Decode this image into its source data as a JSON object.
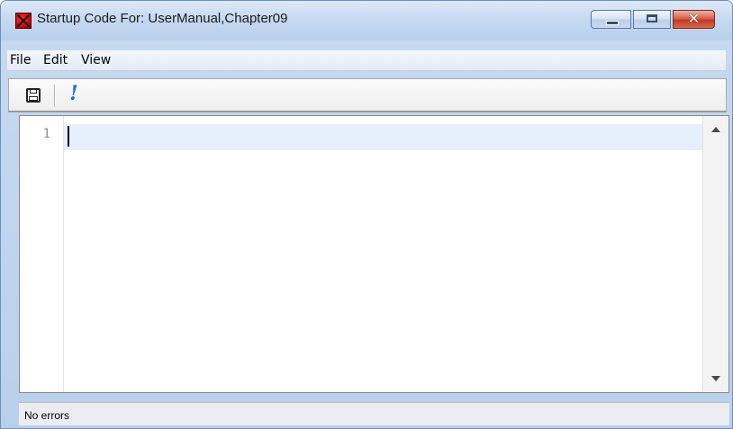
{
  "window": {
    "title": "Startup Code For:  UserManual,Chapter09",
    "app_icon": "red-star-app-icon",
    "controls": {
      "minimize_icon": "minimize-icon",
      "maximize_icon": "maximize-icon",
      "close_glyph": "✕"
    }
  },
  "menu": {
    "items": [
      "File",
      "Edit",
      "View"
    ]
  },
  "toolbar": {
    "save_icon": "save-disk-icon",
    "run_glyph": "!",
    "run_icon": "run-exclamation-icon",
    "run_color": "#1b73c7"
  },
  "editor": {
    "line_numbers": [
      "1"
    ],
    "current_line_highlight": "#e6f0fc",
    "content": ""
  },
  "status": {
    "text": "No errors"
  },
  "colors": {
    "close_button": "#c4391f",
    "titlebar": "#c4d8f0"
  }
}
